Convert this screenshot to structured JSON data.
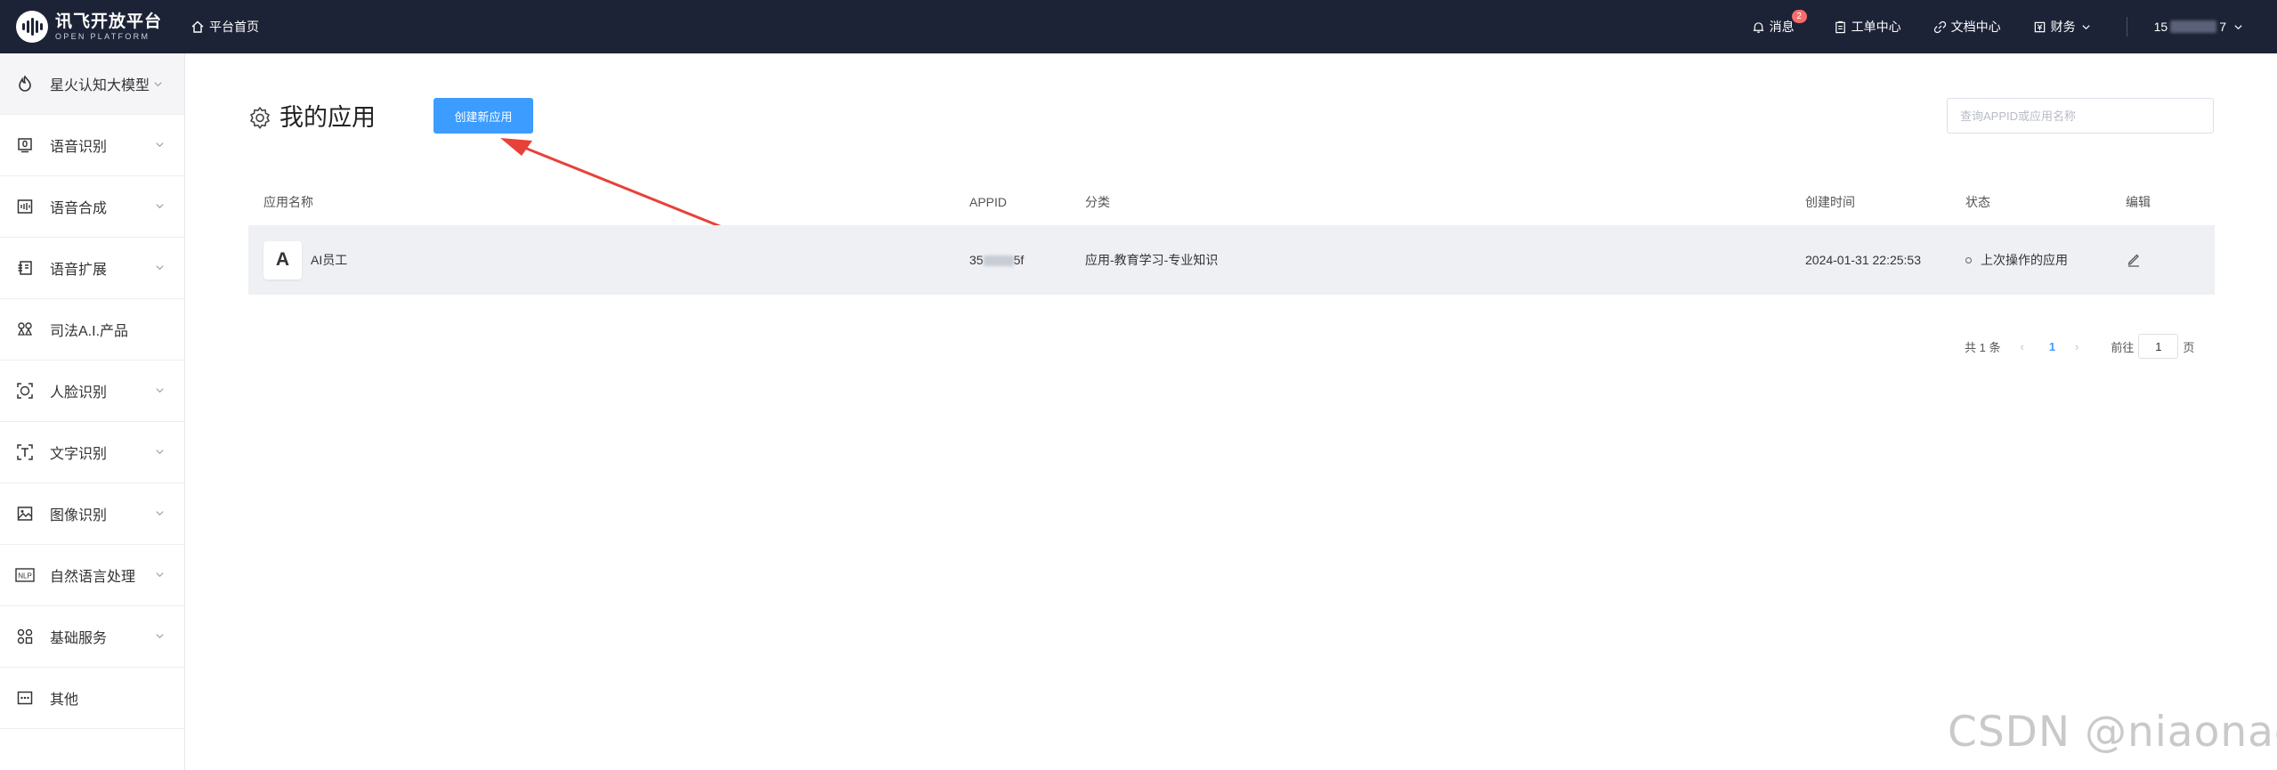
{
  "topbar": {
    "logo_cn": "讯飞开放平台",
    "logo_en": "OPEN PLATFORM",
    "home": "平台首页",
    "nav": [
      {
        "label": "消息",
        "icon": "bell-icon",
        "badge": "2"
      },
      {
        "label": "工单中心",
        "icon": "clipboard-icon"
      },
      {
        "label": "文档中心",
        "icon": "link-icon"
      },
      {
        "label": "财务",
        "icon": "finance-icon",
        "has_dropdown": true
      }
    ],
    "user_prefix": "15",
    "user_suffix": "7"
  },
  "sidebar": {
    "items": [
      {
        "label": "星火认知大模型",
        "icon": "spark-icon"
      },
      {
        "label": "语音识别",
        "icon": "voice-recognition-icon"
      },
      {
        "label": "语音合成",
        "icon": "speech-synthesis-icon"
      },
      {
        "label": "语音扩展",
        "icon": "voice-extension-icon"
      },
      {
        "label": "司法A.I.产品",
        "icon": "judicial-ai-icon"
      },
      {
        "label": "人脸识别",
        "icon": "face-recognition-icon"
      },
      {
        "label": "文字识别",
        "icon": "text-recognition-icon"
      },
      {
        "label": "图像识别",
        "icon": "image-recognition-icon"
      },
      {
        "label": "自然语言处理",
        "icon": "nlp-icon",
        "icon_text": "NLP"
      },
      {
        "label": "基础服务",
        "icon": "basic-services-icon"
      },
      {
        "label": "其他",
        "icon": "more-icon"
      }
    ]
  },
  "main": {
    "title": "我的应用",
    "create_button": "创建新应用",
    "search_placeholder": "查询APPID或应用名称",
    "table": {
      "headers": [
        "应用名称",
        "APPID",
        "分类",
        "创建时间",
        "状态",
        "编辑"
      ],
      "rows": [
        {
          "avatar": "A",
          "name": "AI员工",
          "appid_prefix": "35",
          "appid_suffix": "5f",
          "category": "应用-教育学习-专业知识",
          "created": "2024-01-31 22:25:53",
          "status": "上次操作的应用"
        }
      ]
    },
    "pagination": {
      "total": "共 1 条",
      "current_page": "1",
      "goto_label": "前往",
      "goto_value": "1",
      "page_unit": "页"
    }
  },
  "watermark": "CSDN @niaonao",
  "colors": {
    "topbar_bg": "#1d2336",
    "primary": "#3c9cff",
    "annotation_arrow": "#e8413a"
  }
}
